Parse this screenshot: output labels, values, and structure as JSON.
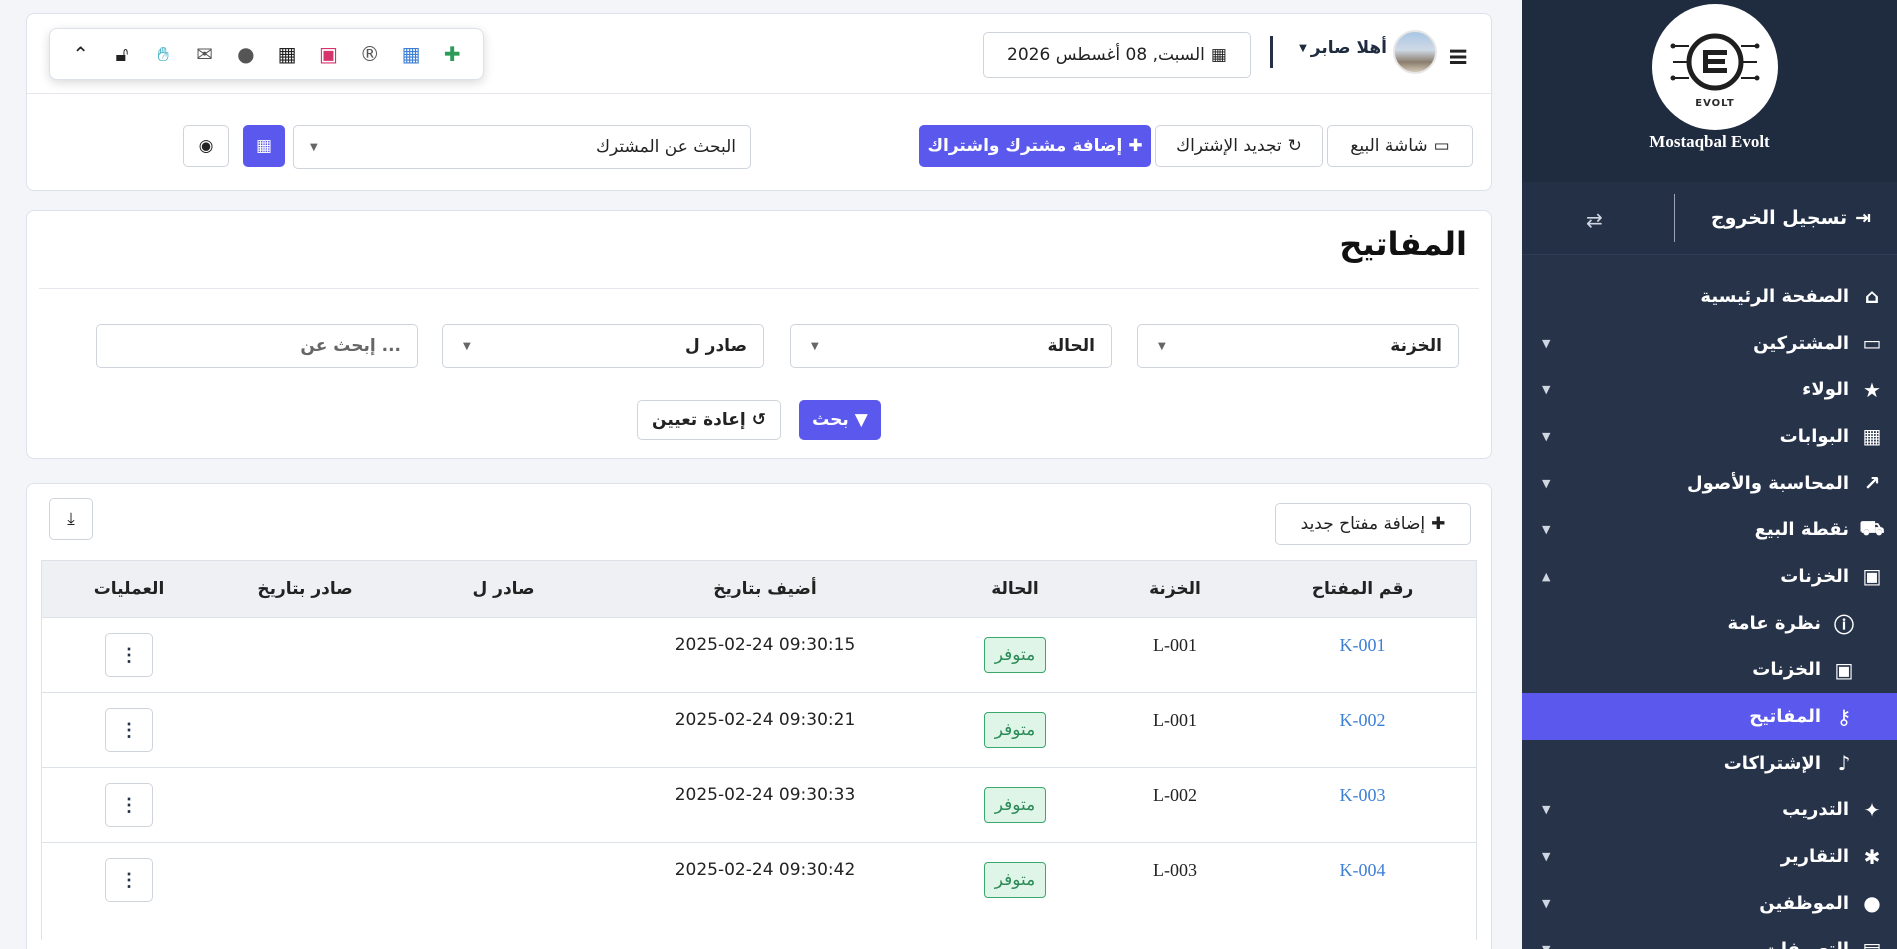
{
  "sidebar": {
    "brand": "Mostaqbal Evolt",
    "logo_text": "EVOLT",
    "logout": "تسجيل الخروج",
    "items": [
      {
        "label": "الصفحة الرئيسية"
      },
      {
        "label": "المشتركين"
      },
      {
        "label": "الولاء"
      },
      {
        "label": "البوابات"
      },
      {
        "label": "المحاسبة والأصول"
      },
      {
        "label": "نقطة البيع"
      },
      {
        "label": "الخزنات"
      },
      {
        "label": "نظرة عامة"
      },
      {
        "label": "الخزنات"
      },
      {
        "label": "المفاتيح"
      },
      {
        "label": "الإشتراكات"
      },
      {
        "label": "التدريب"
      },
      {
        "label": "التقارير"
      },
      {
        "label": "الموظفين"
      },
      {
        "label": "التعريفات"
      }
    ]
  },
  "header": {
    "greeting": "أهلا صابر",
    "date": "السبت, 08 أغسطس 2026",
    "sale_screen": "شاشة البيع",
    "renew_subscription": "تجديد الإشتراك",
    "add_subscriber": "إضافة مشترك واشتراك",
    "subscriber_search": "البحث عن المشترك"
  },
  "filters": {
    "title": "المفاتيح",
    "safe": "الخزنة",
    "status": "الحالة",
    "issued_to": "صادر ل",
    "search_placeholder": "إبحث عن ...",
    "search_btn": "بحث",
    "reset_btn": "إعادة تعيين"
  },
  "keys": {
    "add_key": "إضافة مفتاح جديد",
    "columns": [
      "رقم المفتاح",
      "الخزنة",
      "الحالة",
      "أضيف بتاريخ",
      "صادر ل",
      "صادر بتاريخ",
      "العمليات"
    ],
    "rows": [
      {
        "key": "K-001",
        "safe": "L-001",
        "status": "متوفر",
        "added": "2025-02-24 09:30:15",
        "issued_to": "",
        "issued_at": ""
      },
      {
        "key": "K-002",
        "safe": "L-001",
        "status": "متوفر",
        "added": "2025-02-24 09:30:21",
        "issued_to": "",
        "issued_at": ""
      },
      {
        "key": "K-003",
        "safe": "L-002",
        "status": "متوفر",
        "added": "2025-02-24 09:30:33",
        "issued_to": "",
        "issued_at": ""
      },
      {
        "key": "K-004",
        "safe": "L-003",
        "status": "متوفر",
        "added": "2025-02-24 09:30:42",
        "issued_to": "",
        "issued_at": ""
      }
    ]
  },
  "colors": {
    "primary": "#5b58ee",
    "sidebar": "#233045",
    "success": "#2c8a58"
  }
}
